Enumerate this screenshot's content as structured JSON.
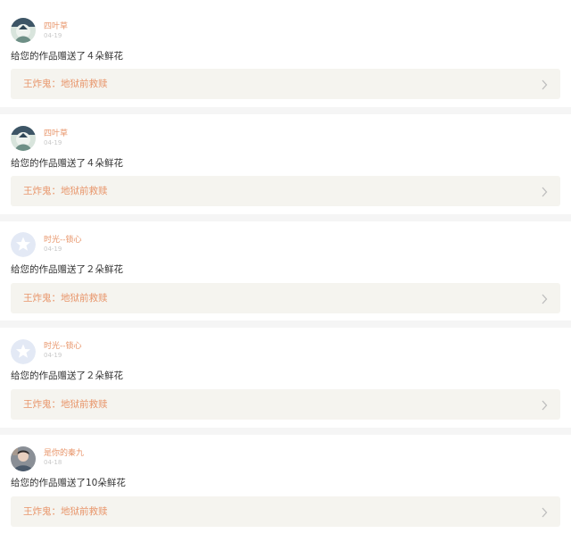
{
  "notifications": [
    {
      "username": "四叶草",
      "date": "04-19",
      "message": "给您的作品赠送了４朵鲜花",
      "work_title": "王炸鬼：地狱前救赎",
      "avatar": "clover-avatar"
    },
    {
      "username": "四叶草",
      "date": "04-19",
      "message": "给您的作品赠送了４朵鲜花",
      "work_title": "王炸鬼：地狱前救赎",
      "avatar": "clover-avatar"
    },
    {
      "username": "时光--锁心",
      "date": "04-19",
      "message": "给您的作品赠送了２朵鲜花",
      "work_title": "王炸鬼：地狱前救赎",
      "avatar": "default-star-avatar"
    },
    {
      "username": "时光--锁心",
      "date": "04-19",
      "message": "给您的作品赠送了２朵鲜花",
      "work_title": "王炸鬼：地狱前救赎",
      "avatar": "default-star-avatar"
    },
    {
      "username": "是你的秦九",
      "date": "04-18",
      "message": "给您的作品赠送了10朵鲜花",
      "work_title": "王炸鬼：地狱前救赎",
      "avatar": "photo-avatar"
    }
  ],
  "colors": {
    "accent": "#e8956a",
    "link_bg": "#f5f4ef",
    "page_bg": "#f5f5f5"
  },
  "icons": {
    "chevron": "chevron-right-icon"
  }
}
